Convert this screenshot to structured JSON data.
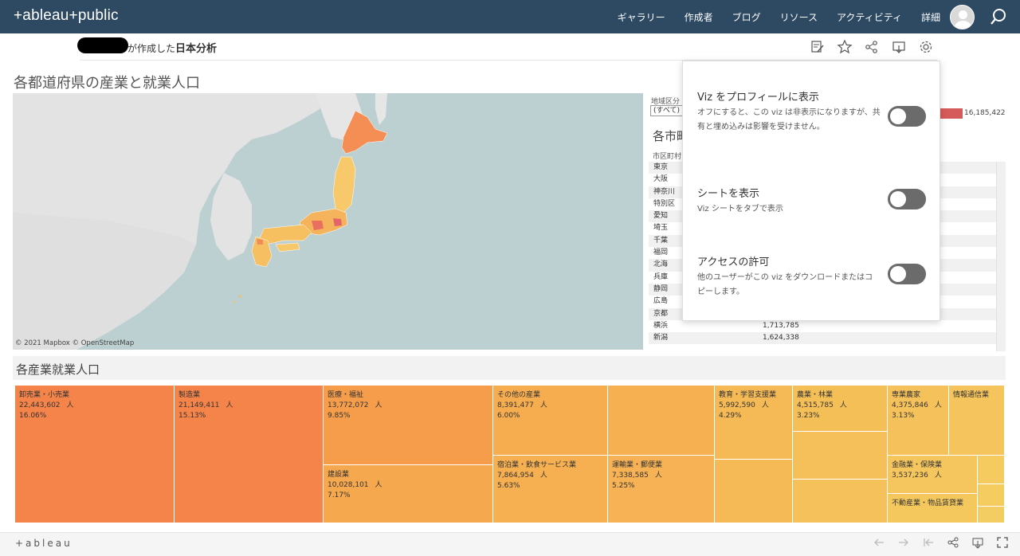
{
  "nav": {
    "logo_text": "+ableau+public",
    "items": [
      "ギャラリー",
      "作成者",
      "ブログ",
      "リソース",
      "アクティビティ",
      "詳細"
    ]
  },
  "title_bar": {
    "author_suffix": "が作成した",
    "viz_name": "日本分析"
  },
  "viz": {
    "heading": "各都道府県の産業と就業人口",
    "map_credit": "© 2021 Mapbox  © OpenStreetMap",
    "region_label": "地域区分",
    "region_value": "(すべて)",
    "legend_value": "16,185,422",
    "city_heading": "各市町村",
    "city_col_head": "市区町村",
    "city_rows": [
      {
        "name": "東京",
        "value": ""
      },
      {
        "name": "大阪",
        "value": ""
      },
      {
        "name": "神奈川",
        "value": ""
      },
      {
        "name": "特別区",
        "value": ""
      },
      {
        "name": "愛知",
        "value": ""
      },
      {
        "name": "埼玉",
        "value": ""
      },
      {
        "name": "千葉",
        "value": ""
      },
      {
        "name": "福岡",
        "value": ""
      },
      {
        "name": "北海",
        "value": ""
      },
      {
        "name": "兵庫",
        "value": ""
      },
      {
        "name": "静岡",
        "value": ""
      },
      {
        "name": "広島",
        "value": ""
      },
      {
        "name": "京都",
        "value": ""
      },
      {
        "name": "横浜",
        "value": "1,713,785"
      },
      {
        "name": "新潟",
        "value": "1,624,338"
      },
      {
        "name": "",
        "value": ""
      }
    ]
  },
  "settings_popup": {
    "settings": [
      {
        "title": "Viz をプロフィールに表示",
        "desc": "オフにすると、この viz は非表示になりますが、共有と埋め込みは影響を受けません。",
        "enabled": false
      },
      {
        "title": "シートを表示",
        "desc": "Viz シートをタブで表示",
        "enabled": false
      },
      {
        "title": "アクセスの許可",
        "desc": "他のユーザーがこの viz をダウンロードまたはコピーします。",
        "enabled": false
      }
    ]
  },
  "industry": {
    "heading": "各産業就業人口",
    "unit": "人",
    "cells": [
      {
        "name": "卸売業・小売業",
        "value": "22,443,602",
        "pct": "16.06%",
        "color": "#f5844a"
      },
      {
        "name": "製造業",
        "value": "21,149,411",
        "pct": "15.13%",
        "color": "#f5844a"
      },
      {
        "name": "医療・福祉",
        "value": "13,772,072",
        "pct": "9.85%",
        "color": "#f59d4b"
      },
      {
        "name": "建設業",
        "value": "10,028,101",
        "pct": "7.17%",
        "color": "#f6a84f"
      },
      {
        "name": "その他の産業",
        "value": "8,391,477",
        "pct": "6.00%",
        "color": "#f6ad50"
      },
      {
        "name": "",
        "value": "",
        "pct": "",
        "color": "#f6b052"
      },
      {
        "name": "宿泊業・飲食サービス業",
        "value": "7,864,954",
        "pct": "5.63%",
        "color": "#f6b052"
      },
      {
        "name": "運輸業・郵便業",
        "value": "7,338,585",
        "pct": "5.25%",
        "color": "#f6b254"
      },
      {
        "name": "教育・学習支援業",
        "value": "5,992,590",
        "pct": "4.29%",
        "color": "#f5ba56"
      },
      {
        "name": "",
        "value": "",
        "pct": "",
        "color": "#f5ba56"
      },
      {
        "name": "農業・林業",
        "value": "4,515,785",
        "pct": "3.23%",
        "color": "#f5bf58"
      },
      {
        "name": "",
        "value": "",
        "pct": "",
        "color": "#f5c05a"
      },
      {
        "name": "",
        "value": "",
        "pct": "",
        "color": "#f5c15a"
      },
      {
        "name": "専業農家",
        "value": "4,375,846",
        "pct": "3.13%",
        "color": "#f5c15b"
      },
      {
        "name": "情報通信業",
        "value": "",
        "pct": "",
        "color": "#f5c45c"
      },
      {
        "name": "金融業・保険業",
        "value": "3,537,236",
        "pct": "",
        "color": "#f5c65d"
      },
      {
        "name": "",
        "value": "",
        "pct": "",
        "color": "#f5ca5f"
      },
      {
        "name": "不動産業・物品賃貸業",
        "value": "",
        "pct": "",
        "color": "#f5c85e"
      },
      {
        "name": "",
        "value": "",
        "pct": "",
        "color": "#f4cc60"
      },
      {
        "name": "",
        "value": "",
        "pct": "",
        "color": "#f4cd62"
      }
    ]
  },
  "footer": {
    "logo_text": "+ableau"
  }
}
